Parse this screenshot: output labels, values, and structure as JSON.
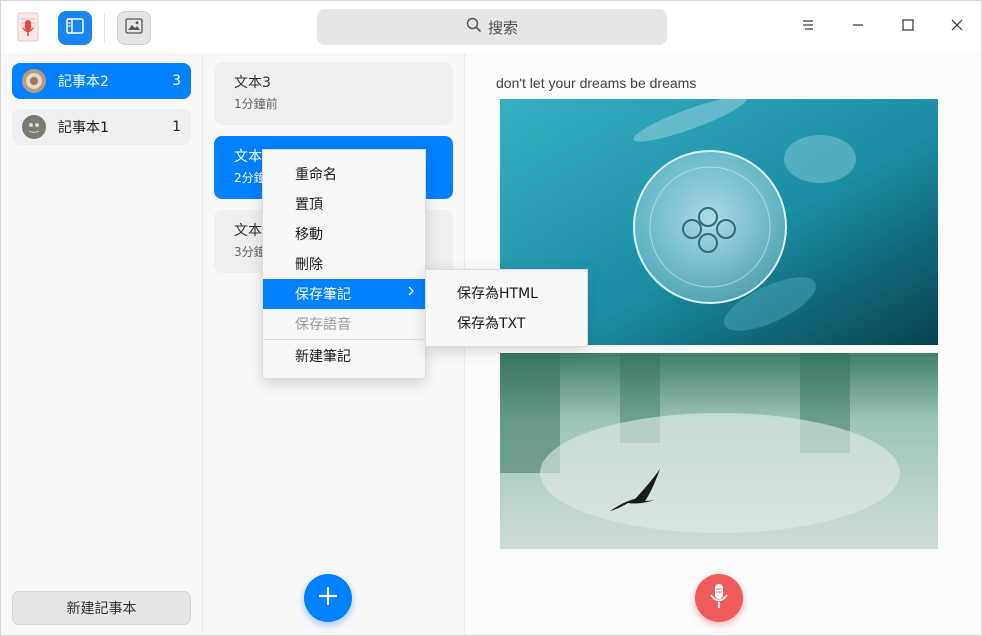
{
  "titlebar": {
    "search_placeholder": "搜索",
    "icons": [
      "notes-app-icon",
      "list-view-icon",
      "image-icon",
      "search-icon",
      "menu-icon",
      "minimize-icon",
      "maximize-icon",
      "close-icon"
    ]
  },
  "notebooks": {
    "items": [
      {
        "name": "記事本2",
        "count": "3",
        "active": true
      },
      {
        "name": "記事本1",
        "count": "1",
        "active": false
      }
    ],
    "new_label": "新建記事本"
  },
  "notes": {
    "items": [
      {
        "title": "文本3",
        "time": "1分鐘前",
        "active": false
      },
      {
        "title": "文本",
        "time": "2分鐘",
        "active": true
      },
      {
        "title": "文本",
        "time": "3分鐘",
        "active": false
      }
    ]
  },
  "content": {
    "text": "don't let your dreams be dreams",
    "images": [
      "jellyfish-image",
      "waterfall-bird-image"
    ]
  },
  "context_menu": {
    "items": [
      "重命名",
      "置頂",
      "移動",
      "刪除",
      "保存筆記",
      "保存語音",
      "新建筆記"
    ],
    "submenu": [
      "保存為HTML",
      "保存為TXT"
    ]
  },
  "colors": {
    "accent": "#0081ff",
    "record": "#ef5b5b"
  }
}
